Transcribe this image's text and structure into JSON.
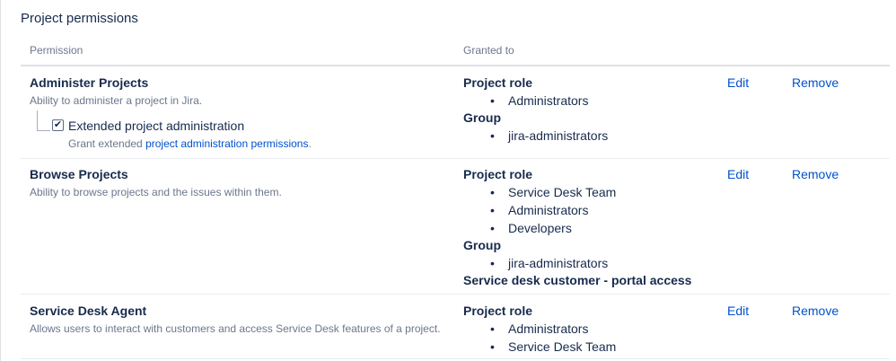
{
  "section": {
    "title": "Project permissions"
  },
  "columns": {
    "permission": "Permission",
    "granted_to": "Granted to"
  },
  "bullet": "•",
  "checkbox_tick": "✔",
  "rows": [
    {
      "name": "Administer Projects",
      "description": "Ability to administer a project in Jira.",
      "extended": {
        "label": "Extended project administration",
        "checked": true,
        "desc_prefix": "Grant extended",
        "desc_link": "project administration permissions",
        "desc_suffix": "."
      },
      "grants": [
        {
          "type": "Project role",
          "items": [
            "Administrators"
          ]
        },
        {
          "type": "Group",
          "items": [
            "jira-administrators"
          ]
        }
      ],
      "edit": "Edit",
      "remove": "Remove"
    },
    {
      "name": "Browse Projects",
      "description": "Ability to browse projects and the issues within them.",
      "grants": [
        {
          "type": "Project role",
          "items": [
            "Service Desk Team",
            "Administrators",
            "Developers"
          ]
        },
        {
          "type": "Group",
          "items": [
            "jira-administrators"
          ]
        },
        {
          "type": "Service desk customer - portal access",
          "items": []
        }
      ],
      "edit": "Edit",
      "remove": "Remove"
    },
    {
      "name": "Service Desk Agent",
      "description": "Allows users to interact with customers and access Service Desk features of a project.",
      "grants": [
        {
          "type": "Project role",
          "items": [
            "Administrators",
            "Service Desk Team"
          ]
        }
      ],
      "edit": "Edit",
      "remove": "Remove"
    }
  ]
}
